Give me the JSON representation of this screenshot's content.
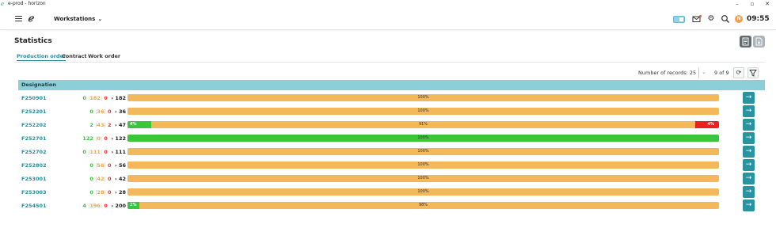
{
  "window": {
    "title": "e-prod - horizon",
    "minimize": "–",
    "maximize": "▫",
    "close": "✕"
  },
  "header": {
    "workstations_label": "Workstations",
    "avatar_initial": "N",
    "time": "09:55",
    "accent_color": "#2a8f9c"
  },
  "page": {
    "title": "Statistics",
    "tabs": [
      {
        "label": "Production order",
        "active": true
      },
      {
        "label": "Contract",
        "active": false
      },
      {
        "label": "Work order",
        "active": false
      }
    ],
    "records_label": "Number of records: 25",
    "pager": "9 of 9"
  },
  "table": {
    "header": "Designation",
    "rows": [
      {
        "name": "F250901",
        "green": "0",
        "orange": "182",
        "red": "0",
        "total": "182",
        "green_pct": 0,
        "red_pct": 0,
        "label": "100%"
      },
      {
        "name": "F252201",
        "green": "0",
        "orange": "36",
        "red": "0",
        "total": "36",
        "green_pct": 0,
        "red_pct": 0,
        "label": "100%"
      },
      {
        "name": "F252202",
        "green": "2",
        "orange": "43",
        "red": "2",
        "total": "47",
        "green_pct": 4,
        "red_pct": 4,
        "green_label": "4%",
        "red_label": "4%",
        "label": "91%"
      },
      {
        "name": "F252701",
        "green": "122",
        "orange": "0",
        "red": "0",
        "total": "122",
        "green_pct": 100,
        "red_pct": 0,
        "label": "100%"
      },
      {
        "name": "F252702",
        "green": "0",
        "orange": "111",
        "red": "0",
        "total": "111",
        "green_pct": 0,
        "red_pct": 0,
        "label": "100%"
      },
      {
        "name": "F252802",
        "green": "0",
        "orange": "56",
        "red": "0",
        "total": "56",
        "green_pct": 0,
        "red_pct": 0,
        "label": "100%"
      },
      {
        "name": "F253001",
        "green": "0",
        "orange": "42",
        "red": "0",
        "total": "42",
        "green_pct": 0,
        "red_pct": 0,
        "label": "100%"
      },
      {
        "name": "F253003",
        "green": "0",
        "orange": "28",
        "red": "0",
        "total": "28",
        "green_pct": 0,
        "red_pct": 0,
        "label": "100%"
      },
      {
        "name": "F254501",
        "green": "4",
        "orange": "196",
        "red": "0",
        "total": "200",
        "green_pct": 2,
        "red_pct": 0,
        "green_label": "2%",
        "label": "98%"
      }
    ],
    "colors": {
      "green": "#3cc43c",
      "orange": "#f3b85a",
      "red": "#f01f1f"
    }
  }
}
